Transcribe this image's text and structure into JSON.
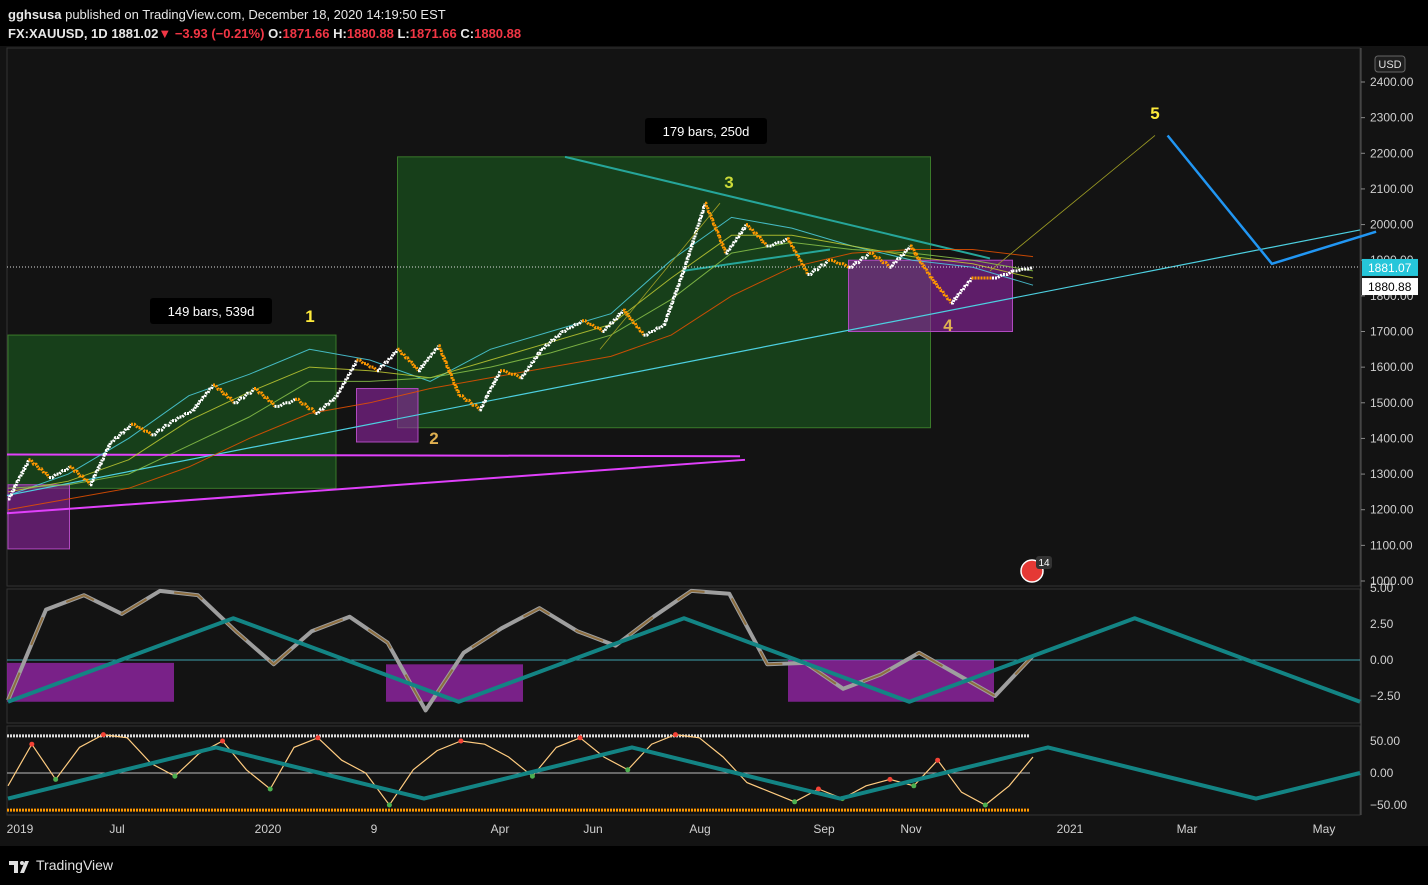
{
  "header": {
    "publisher": "gghsusa",
    "published_text": "published on TradingView.com, December 18, 2020 14:19:50 EST",
    "symbol": "FX:XAUUSD, 1D",
    "last": "1881.02",
    "change_arrow": "▼",
    "change": "−3.93 (−0.21%)",
    "o_label": "O:",
    "o_value": "1871.66",
    "h_label": "H:",
    "h_value": "1880.88",
    "l_label": "L:",
    "l_value": "1871.66",
    "c_label": "C:",
    "c_value": "1880.88"
  },
  "footer": {
    "brand": "TradingView",
    "logo_icon": "tradingview-logo-icon"
  },
  "colors": {
    "background": "#131313",
    "bull_brick": "#ffffff",
    "bear_brick": "#ff9800",
    "green_zone": "#1b5e20",
    "purple_zone": "#9c27b0",
    "wave_teal": "#138484",
    "trend_magenta": "#e040fb",
    "trend_cyan": "#4dd0e1",
    "projection_blue": "#2196f3",
    "price_tag_cyan": "#26c6da"
  },
  "chart_data": [
    {
      "type": "line",
      "title": "",
      "currency": "USD",
      "ylim": [
        950,
        2500
      ],
      "y_ticks": [
        1000,
        1100,
        1200,
        1300,
        1400,
        1500,
        1600,
        1700,
        1800,
        1900,
        2000,
        2100,
        2200,
        2300,
        2400
      ],
      "y_tick_labels": [
        "1000.00",
        "1100.00",
        "1200.00",
        "1300.00",
        "1400.00",
        "1500.00",
        "1600.00",
        "1700.00",
        "1800.00",
        "1900.00",
        "2000.00",
        "2100.00",
        "2200.00",
        "2300.00",
        "2400.00"
      ],
      "x_labels": [
        "2019",
        "Jul",
        "2020",
        "9",
        "Apr",
        "Jun",
        "Aug",
        "Sep",
        "Nov",
        "2021",
        "Mar",
        "May"
      ],
      "price_tags": [
        {
          "label": "1881.07",
          "value": 1881.07,
          "style": "cyan"
        },
        {
          "label": "1880.88",
          "value": 1880.88,
          "style": "white"
        }
      ],
      "renko_path": [
        1230,
        1340,
        1290,
        1320,
        1270,
        1390,
        1440,
        1410,
        1450,
        1480,
        1550,
        1500,
        1540,
        1490,
        1510,
        1470,
        1520,
        1620,
        1590,
        1650,
        1590,
        1660,
        1520,
        1480,
        1590,
        1570,
        1650,
        1700,
        1730,
        1700,
        1760,
        1690,
        1720,
        1880,
        2060,
        1920,
        2000,
        1940,
        1960,
        1860,
        1900,
        1880,
        1920,
        1880,
        1940,
        1850,
        1780,
        1850,
        1850,
        1870,
        1880
      ],
      "series": [
        {
          "values": [
            1240,
            1300,
            1400,
            1520,
            1580,
            1650,
            1620,
            1560,
            1650,
            1700,
            1750,
            1900,
            2020,
            1990,
            1940,
            1900,
            1880,
            1830
          ]
        },
        {
          "values": [
            1250,
            1280,
            1340,
            1450,
            1530,
            1600,
            1590,
            1570,
            1620,
            1670,
            1720,
            1850,
            1970,
            1970,
            1940,
            1910,
            1890,
            1850
          ]
        },
        {
          "values": [
            1260,
            1270,
            1300,
            1380,
            1460,
            1560,
            1560,
            1570,
            1600,
            1640,
            1690,
            1790,
            1920,
            1950,
            1930,
            1920,
            1900,
            1870
          ]
        },
        {
          "values": [
            1200,
            1230,
            1260,
            1320,
            1400,
            1470,
            1500,
            1540,
            1570,
            1600,
            1630,
            1690,
            1800,
            1880,
            1920,
            1930,
            1930,
            1910
          ]
        }
      ],
      "zones": [
        {
          "kind": "green",
          "start": 0,
          "end": 16,
          "low": 1260,
          "high": 1690
        },
        {
          "kind": "green",
          "start": 19,
          "end": 45,
          "low": 1430,
          "high": 2190
        },
        {
          "kind": "purple",
          "start": 0,
          "end": 3,
          "low": 1090,
          "high": 1270
        },
        {
          "kind": "purple",
          "start": 17,
          "end": 20,
          "low": 1390,
          "high": 1540
        },
        {
          "kind": "purple",
          "start": 41,
          "end": 49,
          "low": 1700,
          "high": 1900
        }
      ],
      "wave_labels": [
        {
          "label": "1",
          "value": 1720,
          "at": 14
        },
        {
          "label": "2",
          "value": 1400,
          "at": 19
        },
        {
          "label": "3",
          "value": 2110,
          "at": 33
        },
        {
          "label": "4",
          "value": 1720,
          "at": 45
        },
        {
          "label": "5",
          "value": 2320,
          "at": 55
        }
      ],
      "range_labels": [
        {
          "label": "149 bars, 539d",
          "value": 1750,
          "at": 9
        },
        {
          "label": "179 bars, 250d",
          "value": 2280,
          "at": 33
        }
      ],
      "projection": [
        {
          "at": 56,
          "value": 2250
        },
        {
          "at": 61,
          "value": 1890
        },
        {
          "at": 66,
          "value": 1980
        }
      ],
      "event_badge": "14"
    },
    {
      "type": "line",
      "title": "",
      "ylim": [
        -5.2,
        5.2
      ],
      "y_ticks": [
        5.0,
        2.5,
        0.0,
        -2.5
      ],
      "y_tick_labels": [
        "5.00",
        "2.50",
        "0.00",
        "−2.50"
      ],
      "series": [
        {
          "values": [
            -2.8,
            3.5,
            4.5,
            3.2,
            4.8,
            4.5,
            2.0,
            -0.3,
            2.0,
            3.0,
            1.2,
            -3.5,
            0.5,
            2.2,
            3.6,
            2.0,
            1.0,
            3.0,
            4.8,
            4.6,
            -0.3,
            -0.2,
            -2.0,
            -1.0,
            0.5,
            -1.0,
            -2.5,
            0.3
          ]
        },
        {
          "values": [
            -2.9,
            0,
            2.9,
            0,
            -2.9,
            0,
            2.9,
            0,
            -2.9,
            0,
            2.9,
            0,
            -2.9
          ]
        }
      ]
    },
    {
      "type": "line",
      "title": "",
      "ylim": [
        -62,
        62
      ],
      "y_ticks": [
        50,
        0,
        -50
      ],
      "y_tick_labels": [
        "50.00",
        "0.00",
        "−50.00"
      ],
      "series": [
        {
          "values": [
            -20,
            45,
            -10,
            40,
            60,
            55,
            15,
            -5,
            30,
            50,
            5,
            -25,
            40,
            55,
            20,
            0,
            -50,
            5,
            35,
            50,
            45,
            25,
            -5,
            40,
            55,
            25,
            5,
            45,
            60,
            55,
            25,
            -15,
            -30,
            -45,
            -25,
            -40,
            -20,
            -10,
            -20,
            20,
            -30,
            -50,
            -20,
            25
          ]
        },
        {
          "values": [
            -40,
            0,
            40,
            0,
            -40,
            0,
            40,
            0,
            -40,
            0,
            40,
            0,
            -40,
            0
          ]
        }
      ]
    }
  ]
}
